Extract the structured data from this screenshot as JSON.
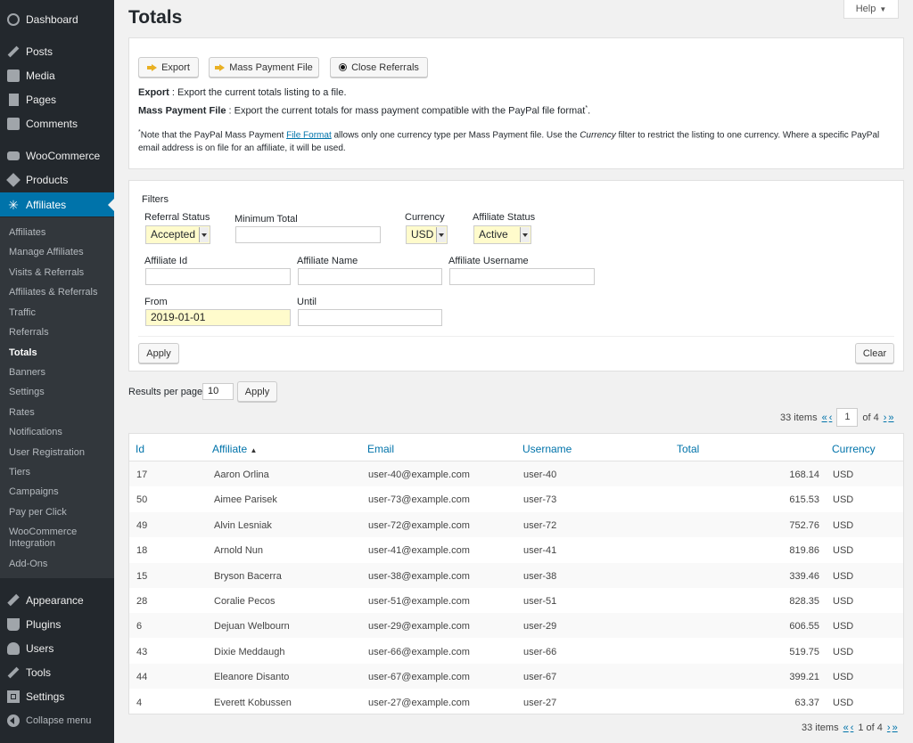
{
  "sidebar": {
    "top_items": [
      {
        "label": "Dashboard",
        "icon": "dashboard-icon"
      },
      {
        "label": "Posts",
        "icon": "pin-icon"
      },
      {
        "label": "Media",
        "icon": "media-icon"
      },
      {
        "label": "Pages",
        "icon": "pages-icon"
      },
      {
        "label": "Comments",
        "icon": "comments-icon"
      },
      {
        "label": "WooCommerce",
        "icon": "woocommerce-icon"
      },
      {
        "label": "Products",
        "icon": "products-icon"
      },
      {
        "label": "Affiliates",
        "icon": "affiliates-icon",
        "active": true
      }
    ],
    "sub_items": [
      {
        "label": "Affiliates"
      },
      {
        "label": "Manage Affiliates"
      },
      {
        "label": "Visits & Referrals"
      },
      {
        "label": "Affiliates & Referrals"
      },
      {
        "label": "Traffic"
      },
      {
        "label": "Referrals"
      },
      {
        "label": "Totals",
        "current": true
      },
      {
        "label": "Banners"
      },
      {
        "label": "Settings"
      },
      {
        "label": "Rates"
      },
      {
        "label": "Notifications"
      },
      {
        "label": "User Registration"
      },
      {
        "label": "Tiers"
      },
      {
        "label": "Campaigns"
      },
      {
        "label": "Pay per Click"
      },
      {
        "label": "WooCommerce Integration"
      },
      {
        "label": "Add-Ons"
      }
    ],
    "bottom_items": [
      {
        "label": "Appearance",
        "icon": "appearance-icon"
      },
      {
        "label": "Plugins",
        "icon": "plugins-icon"
      },
      {
        "label": "Users",
        "icon": "users-icon"
      },
      {
        "label": "Tools",
        "icon": "tools-icon"
      },
      {
        "label": "Settings",
        "icon": "settings-icon"
      }
    ],
    "collapse_label": "Collapse menu",
    "colors": {
      "bg": "#23282d",
      "submenu_bg": "#32373c",
      "active": "#0073aa"
    }
  },
  "page": {
    "title": "Totals",
    "help_label": "Help",
    "help_arrow": "▼"
  },
  "actions": {
    "export_label": "Export",
    "mass_payment_label": "Mass Payment File",
    "close_referrals_label": "Close Referrals",
    "export_desc_bold": "Export",
    "export_desc": " : Export the current totals listing to a file.",
    "mass_desc_bold": "Mass Payment File",
    "mass_desc": " : Export the current totals for mass payment compatible with the PayPal file format",
    "mass_desc_sup": "*",
    "mass_desc_end": ".",
    "note_sup": "*",
    "note_a": "Note that the PayPal Mass Payment ",
    "note_link": "File Format",
    "note_b": " allows only one currency type per Mass Payment file. Use the ",
    "note_em": "Currency",
    "note_c": " filter to restrict the listing to one currency. Where a specific PayPal email address is on file for an affiliate, it will be used."
  },
  "filters": {
    "heading": "Filters",
    "referral_status_label": "Referral Status",
    "referral_status_value": "Accepted",
    "minimum_total_label": "Minimum Total",
    "minimum_total_value": "",
    "currency_label": "Currency",
    "currency_value": "USD",
    "affiliate_status_label": "Affiliate Status",
    "affiliate_status_value": "Active",
    "affiliate_id_label": "Affiliate Id",
    "affiliate_name_label": "Affiliate Name",
    "affiliate_username_label": "Affiliate Username",
    "from_label": "From",
    "from_value": "2019-01-01",
    "until_label": "Until",
    "until_value": "",
    "apply_label": "Apply",
    "clear_label": "Clear"
  },
  "results": {
    "per_page_label": "Results per page",
    "per_page_value": "10",
    "apply_label": "Apply"
  },
  "pagination": {
    "items": "33 items",
    "first": "«",
    "prev": "‹",
    "current": "1",
    "of_total": "of 4",
    "next": "›",
    "last": "»",
    "bottom_text": "1 of 4"
  },
  "table": {
    "headers": [
      "Id",
      "Affiliate",
      "Email",
      "Username",
      "Total",
      "Currency"
    ],
    "sort_indicator": "▲",
    "rows": [
      [
        "17",
        "Aaron Orlina",
        "user-40@example.com",
        "user-40",
        "168.14",
        "USD"
      ],
      [
        "50",
        "Aimee Parisek",
        "user-73@example.com",
        "user-73",
        "615.53",
        "USD"
      ],
      [
        "49",
        "Alvin Lesniak",
        "user-72@example.com",
        "user-72",
        "752.76",
        "USD"
      ],
      [
        "18",
        "Arnold Nun",
        "user-41@example.com",
        "user-41",
        "819.86",
        "USD"
      ],
      [
        "15",
        "Bryson Bacerra",
        "user-38@example.com",
        "user-38",
        "339.46",
        "USD"
      ],
      [
        "28",
        "Coralie Pecos",
        "user-51@example.com",
        "user-51",
        "828.35",
        "USD"
      ],
      [
        "6",
        "Dejuan Welbourn",
        "user-29@example.com",
        "user-29",
        "606.55",
        "USD"
      ],
      [
        "43",
        "Dixie Meddaugh",
        "user-66@example.com",
        "user-66",
        "519.75",
        "USD"
      ],
      [
        "44",
        "Eleanore Disanto",
        "user-67@example.com",
        "user-67",
        "399.21",
        "USD"
      ],
      [
        "4",
        "Everett Kobussen",
        "user-27@example.com",
        "user-27",
        "63.37",
        "USD"
      ]
    ]
  }
}
